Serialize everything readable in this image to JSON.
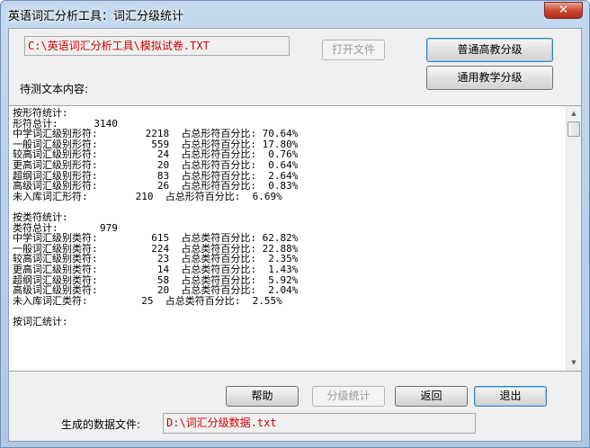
{
  "window": {
    "title": "英语词汇分析工具：词汇分级统计",
    "close_glyph": "✕"
  },
  "file": {
    "path": "C:\\英语词汇分析工具\\模拟试卷.TXT",
    "open_button": "打开文件"
  },
  "right_buttons": {
    "primary": "普通高教分级",
    "secondary": "通用教学分级"
  },
  "text_label": "待测文本内容:",
  "text_lines": [
    "按形符统计:",
    "形符总计:      3140",
    "中学词汇级别形符:        2218  占总形符百分比: 70.64%",
    "一般词汇级别形符:         559  占总形符百分比: 17.80%",
    "较高词汇级别形符:          24  占总形符百分比:  0.76%",
    "更高词汇级别形符:          20  占总形符百分比:  0.64%",
    "超纲词汇级别形符:          83  占总形符百分比:  2.64%",
    "高级词汇级别形符:          26  占总形符百分比:  0.83%",
    "未入库词汇形符:        210  占总形符百分比:  6.69%",
    "",
    "按类符统计:",
    "类符总计:       979",
    "中学词汇级别类符:         615  占总类符百分比: 62.82%",
    "一般词汇级别类符:         224  占总类符百分比: 22.88%",
    "较高词汇级别类符:          23  占总类符百分比:  2.35%",
    "更高词汇级别类符:          14  占总类符百分比:  1.43%",
    "超纲词汇级别类符:          58  占总类符百分比:  5.92%",
    "高级词汇级别类符:          20  占总类符百分比:  2.04%",
    "未入库词汇类符:         25  占总类符百分比:  2.55%",
    "",
    "按词汇统计:"
  ],
  "bottom_buttons": {
    "help": "帮助",
    "grade_stats": "分级统计",
    "back": "返回",
    "exit": "退出"
  },
  "output": {
    "label": "生成的数据文件:",
    "path": "D:\\词汇分级数据.txt"
  },
  "scrollbar": {
    "up": "▲",
    "down": "▼"
  }
}
